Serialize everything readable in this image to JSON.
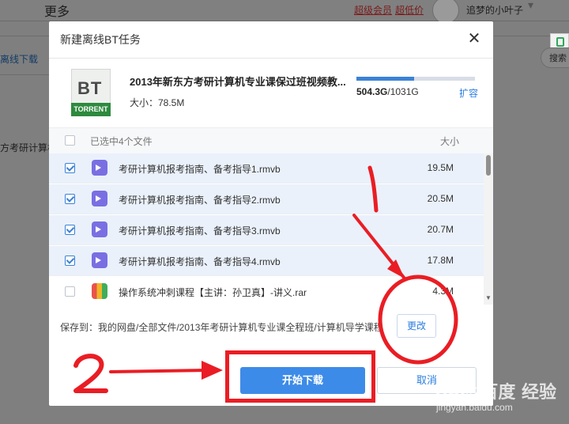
{
  "background": {
    "more_label": "更多",
    "vip_label": "超级会员",
    "vip_price_label": "超低价",
    "username": "追梦的小叶子",
    "offline_download_label": "离线下载",
    "course_prefix": "方考研计算机",
    "search_label": "搜索"
  },
  "dialog": {
    "title": "新建离线BT任务",
    "close_glyph": "✕",
    "torrent_icon": {
      "big_text": "BT",
      "tag_text": "TORRENT"
    },
    "file_title": "2013年新东方考研计算机专业课保过班视频教...",
    "file_size": "大小：78.5M",
    "storage": {
      "used": "504.3G",
      "total": "/1031G",
      "used_fraction": 0.489,
      "expand_label": "扩容"
    },
    "list_header": {
      "selected_text": "已选中4个文件",
      "size_header": "大小"
    },
    "files": [
      {
        "name": "考研计算机报考指南、备考指导1.rmvb",
        "size": "19.5M",
        "checked": true,
        "type": "video"
      },
      {
        "name": "考研计算机报考指南、备考指导2.rmvb",
        "size": "20.5M",
        "checked": true,
        "type": "video"
      },
      {
        "name": "考研计算机报考指南、备考指导3.rmvb",
        "size": "20.7M",
        "checked": true,
        "type": "video"
      },
      {
        "name": "考研计算机报考指南、备考指导4.rmvb",
        "size": "17.8M",
        "checked": true,
        "type": "video"
      },
      {
        "name": "操作系统冲刺课程【主讲：孙卫真】-讲义.rar",
        "size": "4.3M",
        "checked": false,
        "type": "archive"
      }
    ],
    "save_to": "保存到：我的网盘/全部文件/2013年考研计算机专业课全程班/计算机导学课程",
    "change_label": "更改",
    "start_label": "开始下载",
    "cancel_label": "取消"
  },
  "annotations": {
    "marker_1": "1",
    "marker_2": "2",
    "color": "#ea1d24"
  },
  "watermark": {
    "brand": "Bai◎百度 经验",
    "url": "jingyan.baidu.com"
  }
}
